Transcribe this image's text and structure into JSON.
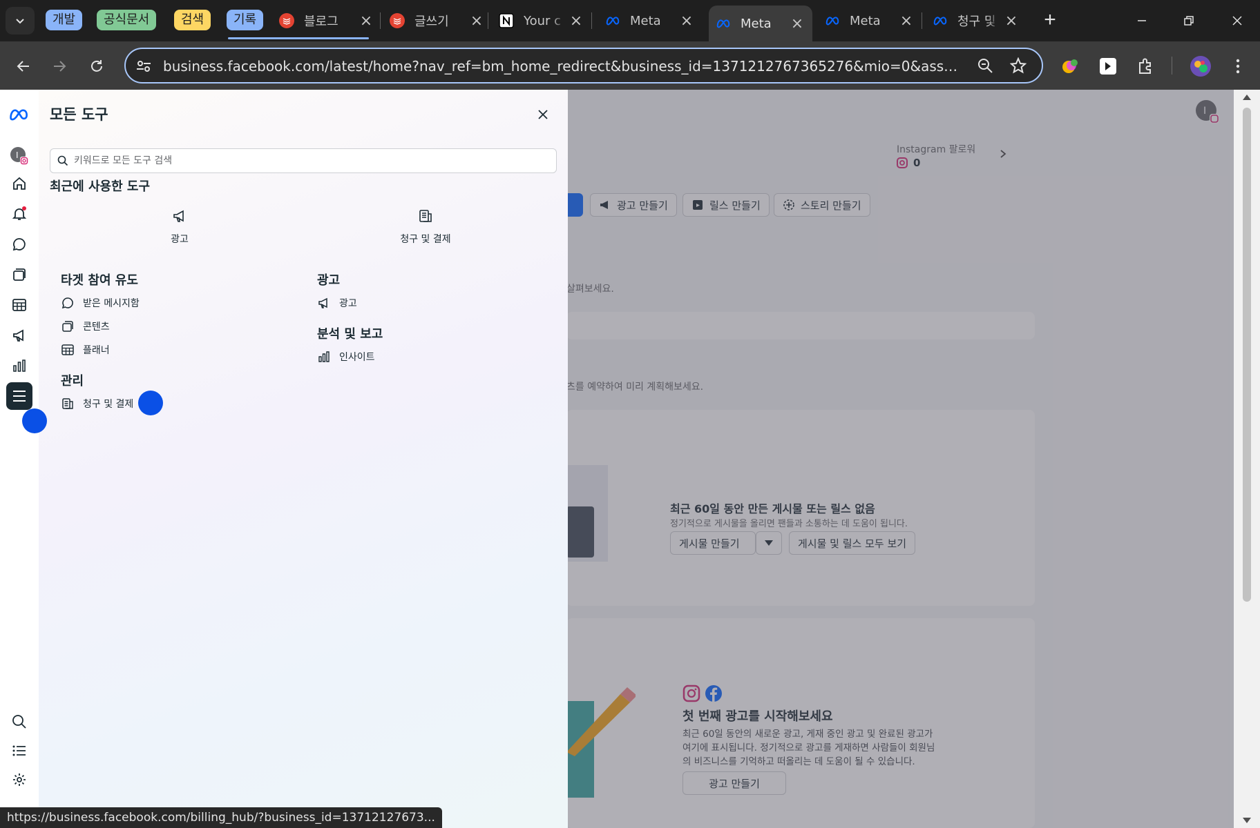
{
  "browser": {
    "tab_groups": [
      {
        "label": "개발",
        "color": "#8ab4f8"
      },
      {
        "label": "공식문서",
        "color": "#81c995"
      },
      {
        "label": "검색",
        "color": "#fdd663"
      },
      {
        "label": "기록",
        "color": "#8ab4f8"
      }
    ],
    "tabs": [
      {
        "title": "블로그",
        "icon": "todoist-icon"
      },
      {
        "title": "글쓰기",
        "icon": "todoist-icon"
      },
      {
        "title": "Your c",
        "icon": "notion-icon"
      },
      {
        "title": "Meta",
        "icon": "meta-icon"
      },
      {
        "title": "Meta",
        "icon": "meta-icon",
        "active": true
      },
      {
        "title": "Meta",
        "icon": "meta-icon"
      },
      {
        "title": "청구 및",
        "icon": "meta-icon"
      }
    ],
    "url": "business.facebook.com/latest/home?nav_ref=bm_home_redirect&business_id=1371212767365276&mio=0&asset_id=60...",
    "status_url": "https://business.facebook.com/billing_hub/?business_id=13712127673..."
  },
  "background": {
    "followers_label": "Instagram 팔로워",
    "followers_value": "0",
    "action_buttons": [
      "광고 만들기",
      "릴스 만들기",
      "스토리 만들기"
    ],
    "partial_text_1": "살펴보세요.",
    "partial_text_2": "츠를 예약하여 미리 계획해보세요.",
    "posts_empty_title": "최근 60일 동안 만든 게시물 또는 릴스 없음",
    "posts_empty_desc": "정기적으로 게시물을 올리면 팬들과 소통하는 데 도움이 됩니다.",
    "create_post_btn": "게시물 만들기",
    "view_all_btn": "게시물 및 릴스 모두 보기",
    "ads_title": "첫 번째 광고를 시작해보세요",
    "ads_desc_1": "최근 60일 동안의 새로운 광고, 게재 중인 광고 및 완료된 광고가",
    "ads_desc_2": "여기에 표시됩니다. 정기적으로 광고를 게재하면 사람들이 회원님",
    "ads_desc_3": "의 비즈니스를 기억하고 떠올리는 데 도움이 될 수 있습니다.",
    "ads_create_btn": "광고 만들기"
  },
  "drawer": {
    "title": "모든 도구",
    "search_placeholder": "키워드로 모든 도구 검색",
    "recent_title": "최근에 사용한 도구",
    "recent": [
      {
        "label": "광고",
        "icon": "megaphone-icon"
      },
      {
        "label": "청구 및 결제",
        "icon": "billing-icon"
      }
    ],
    "sections": {
      "engage": {
        "title": "타겟 참여 유도",
        "items": [
          {
            "label": "받은 메시지함",
            "icon": "chat-icon"
          },
          {
            "label": "콘텐츠",
            "icon": "content-icon"
          },
          {
            "label": "플래너",
            "icon": "planner-icon"
          }
        ]
      },
      "manage": {
        "title": "관리",
        "items": [
          {
            "label": "청구 및 결제",
            "icon": "billing-icon"
          }
        ]
      },
      "ads": {
        "title": "광고",
        "items": [
          {
            "label": "광고",
            "icon": "megaphone-icon"
          }
        ]
      },
      "analytics": {
        "title": "분석 및 보고",
        "items": [
          {
            "label": "인사이트",
            "icon": "insights-icon"
          }
        ]
      }
    }
  },
  "colors": {
    "meta_blue": "#0866ff",
    "touch_indicator": "#0a50e6",
    "rail_active": "#1c2b33"
  }
}
